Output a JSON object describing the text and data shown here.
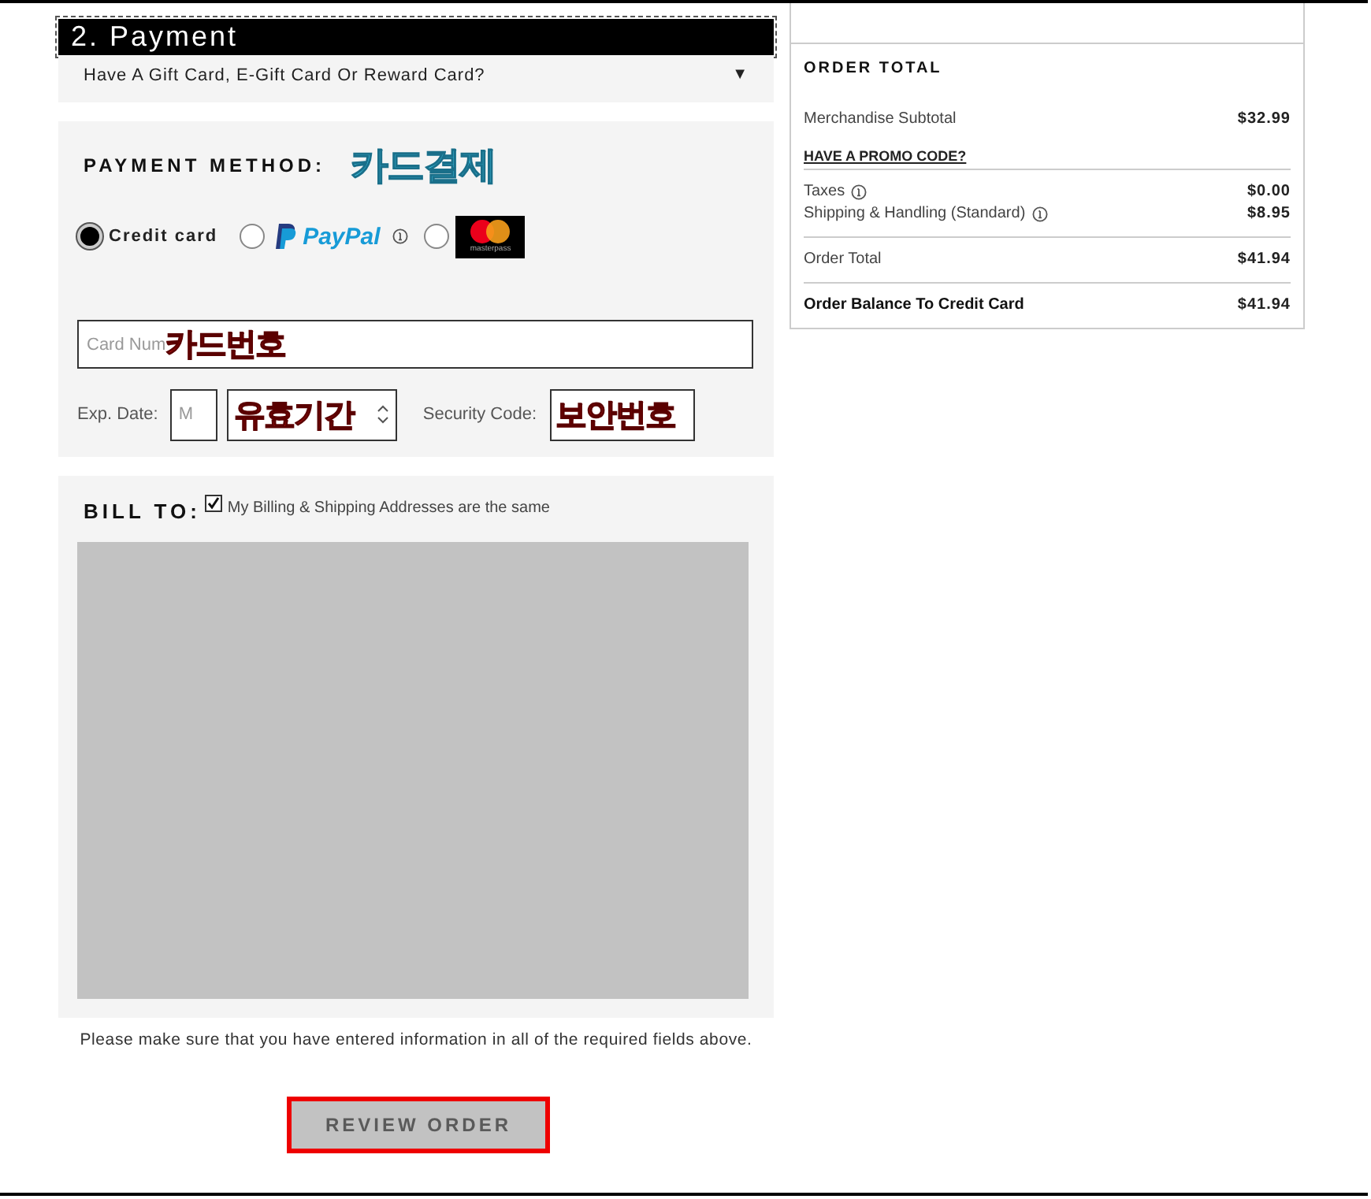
{
  "section_title": "2. Payment",
  "gift_card": {
    "label": "Have A Gift Card, E-Gift Card Or Reward Card?",
    "toggle": "▼"
  },
  "payment_method": {
    "heading": "PAYMENT METHOD:",
    "annotation": "카드결제",
    "options": [
      {
        "kind": "card",
        "label": "Credit card",
        "selected": true
      },
      {
        "kind": "paypal",
        "label": "PayPal",
        "selected": false
      },
      {
        "kind": "masterpass",
        "label": "masterpass",
        "selected": false
      }
    ]
  },
  "card_number": {
    "placeholder": "Card Num",
    "annotation": "카드번호"
  },
  "expiry": {
    "label": "Exp. Date:",
    "month_placeholder": "M",
    "annotation": "유효기간"
  },
  "security": {
    "label": "Security Code:",
    "annotation": "보안번호"
  },
  "bill_to": {
    "heading": "BILL TO:",
    "same_address": {
      "label": "My Billing & Shipping Addresses are the same",
      "checked": true
    }
  },
  "notice": "Please make sure that you have entered information in all of the required fields above.",
  "review_button": {
    "label": "REVIEW ORDER",
    "disabled": true
  },
  "order_total": {
    "heading": "ORDER TOTAL",
    "subtotal": {
      "label": "Merchandise Subtotal",
      "amount": "$32.99"
    },
    "promo_link": "HAVE A PROMO CODE?",
    "groups": [
      [
        {
          "label": "Taxes",
          "info": true,
          "amount": "$0.00",
          "strong": false
        },
        {
          "label": "Shipping & Handling (Standard)",
          "info": true,
          "amount": "$8.95",
          "strong": false
        }
      ],
      [
        {
          "label": "Order Total",
          "info": false,
          "amount": "$41.94",
          "strong": false
        }
      ],
      [
        {
          "label": "Order Balance To Credit Card",
          "info": false,
          "amount": "$41.94",
          "strong": true
        }
      ]
    ]
  }
}
